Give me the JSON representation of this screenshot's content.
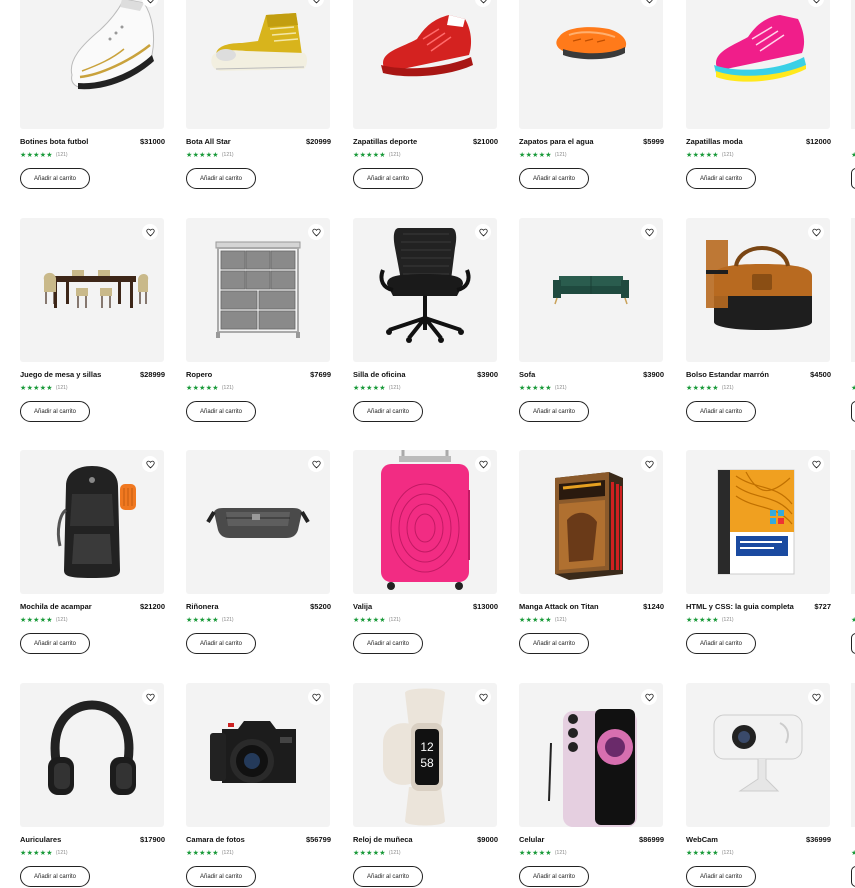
{
  "products": [
    {
      "name": "Botines bota futbol",
      "price": "$31000",
      "image": "soccer-cleat"
    },
    {
      "name": "Bota All Star",
      "price": "$20999",
      "image": "yellow-boot"
    },
    {
      "name": "Zapatillas deporte",
      "price": "$21000",
      "image": "red-sneaker"
    },
    {
      "name": "Zapatos para el agua",
      "price": "$5999",
      "image": "water-shoe"
    },
    {
      "name": "Zapatillas moda",
      "price": "$12000",
      "image": "pink-sneaker"
    },
    {
      "name": "Juego de mesa y sillas",
      "price": "$28999",
      "image": "dining-set"
    },
    {
      "name": "Ropero",
      "price": "$7699",
      "image": "drawer-wardrobe"
    },
    {
      "name": "Silla de oficina",
      "price": "$3900",
      "image": "office-chair"
    },
    {
      "name": "Sofa",
      "price": "$3900",
      "image": "green-sofa"
    },
    {
      "name": "Bolso Estandar marrón",
      "price": "$4500",
      "image": "duffel-bag"
    },
    {
      "name": "Mochila de acampar",
      "price": "$21200",
      "image": "backpack"
    },
    {
      "name": "Riñonera",
      "price": "$5200",
      "image": "waist-bag"
    },
    {
      "name": "Valija",
      "price": "$13000",
      "image": "pink-suitcase"
    },
    {
      "name": "Manga Attack on Titan",
      "price": "$1240",
      "image": "manga-box-set"
    },
    {
      "name": "HTML y CSS: la guia completa.",
      "price": "$727",
      "image": "html-css-book"
    },
    {
      "name": "Auriculares",
      "price": "$17900",
      "image": "headphones"
    },
    {
      "name": "Camara de fotos",
      "price": "$56799",
      "image": "camera"
    },
    {
      "name": "Reloj de muñeca",
      "price": "$9000",
      "image": "fitness-watch"
    },
    {
      "name": "Celular",
      "price": "$86999",
      "image": "smartphone"
    },
    {
      "name": "WebCam",
      "price": "$36999",
      "image": "webcam"
    }
  ],
  "rating": {
    "stars": "★★★★★",
    "count": "(121)"
  },
  "add_to_cart_label": "Añadir al carrito",
  "colors": {
    "card_bg": "#f3f3f3",
    "stars": "#1a9a3a",
    "text": "#111111"
  }
}
